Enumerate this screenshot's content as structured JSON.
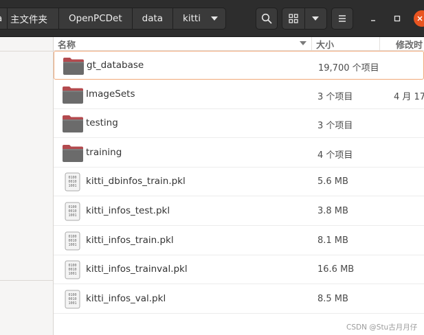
{
  "path_bar": {
    "crumbs": [
      "主文件夹",
      "OpenPCDet",
      "data",
      "kitti"
    ],
    "first_crumb_partial_glyph": "a"
  },
  "toolbar": {
    "search_icon": "search-icon",
    "view_icon": "grid-view-icon",
    "view_options_icon": "chevron-down-icon",
    "menu_icon": "hamburger-menu-icon"
  },
  "window_controls": {
    "minimize_icon": "minimize-icon",
    "maximize_icon": "maximize-icon",
    "close_icon": "close-icon",
    "close_color": "#e95420"
  },
  "columns": {
    "name": "名称",
    "size": "大小",
    "modified": "修改时"
  },
  "files": [
    {
      "name": "gt_database",
      "size": "19,700 个项目",
      "date": "",
      "type": "folder",
      "selected": true
    },
    {
      "name": "ImageSets",
      "size": "3 个项目",
      "date": "4 月 17",
      "type": "folder",
      "selected": false
    },
    {
      "name": "testing",
      "size": "3 个项目",
      "date": "",
      "type": "folder",
      "selected": false
    },
    {
      "name": "training",
      "size": "4 个项目",
      "date": "",
      "type": "folder",
      "selected": false
    },
    {
      "name": "kitti_dbinfos_train.pkl",
      "size": "5.6 MB",
      "date": "",
      "type": "binary",
      "selected": false
    },
    {
      "name": "kitti_infos_test.pkl",
      "size": "3.8 MB",
      "date": "",
      "type": "binary",
      "selected": false
    },
    {
      "name": "kitti_infos_train.pkl",
      "size": "8.1 MB",
      "date": "",
      "type": "binary",
      "selected": false
    },
    {
      "name": "kitti_infos_trainval.pkl",
      "size": "16.6 MB",
      "date": "",
      "type": "binary",
      "selected": false
    },
    {
      "name": "kitti_infos_val.pkl",
      "size": "8.5 MB",
      "date": "",
      "type": "binary",
      "selected": false
    }
  ],
  "binary_icon_text": [
    "0100",
    "0010",
    "1001"
  ],
  "watermark": "CSDN @Stu古月月仔",
  "colors": {
    "headerbar": "#2d2d2d",
    "folder_tab": "#b34a4e",
    "folder_body": "#6b6b6b",
    "selection_border": "#f0a878",
    "accent": "#e95420"
  }
}
